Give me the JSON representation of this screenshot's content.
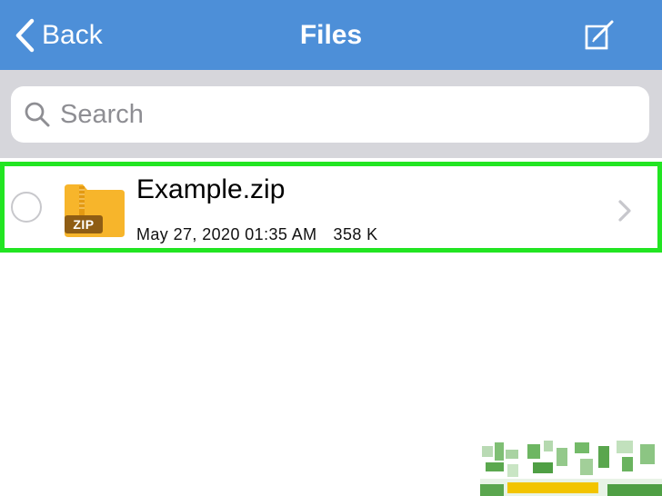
{
  "navbar": {
    "back_label": "Back",
    "title": "Files",
    "compose_icon": "compose-icon",
    "background_color": "#4d8fd8"
  },
  "search": {
    "placeholder": "Search",
    "value": ""
  },
  "files": [
    {
      "name": "Example.zip",
      "date": "May 27, 2020 01:35 AM",
      "size": "358 K",
      "icon": "zip-folder-icon",
      "icon_badge": "ZIP",
      "selected": false
    }
  ],
  "colors": {
    "highlight_border": "#22e522",
    "search_area_bg": "#d6d6db",
    "folder_icon": "#f7b52b"
  }
}
